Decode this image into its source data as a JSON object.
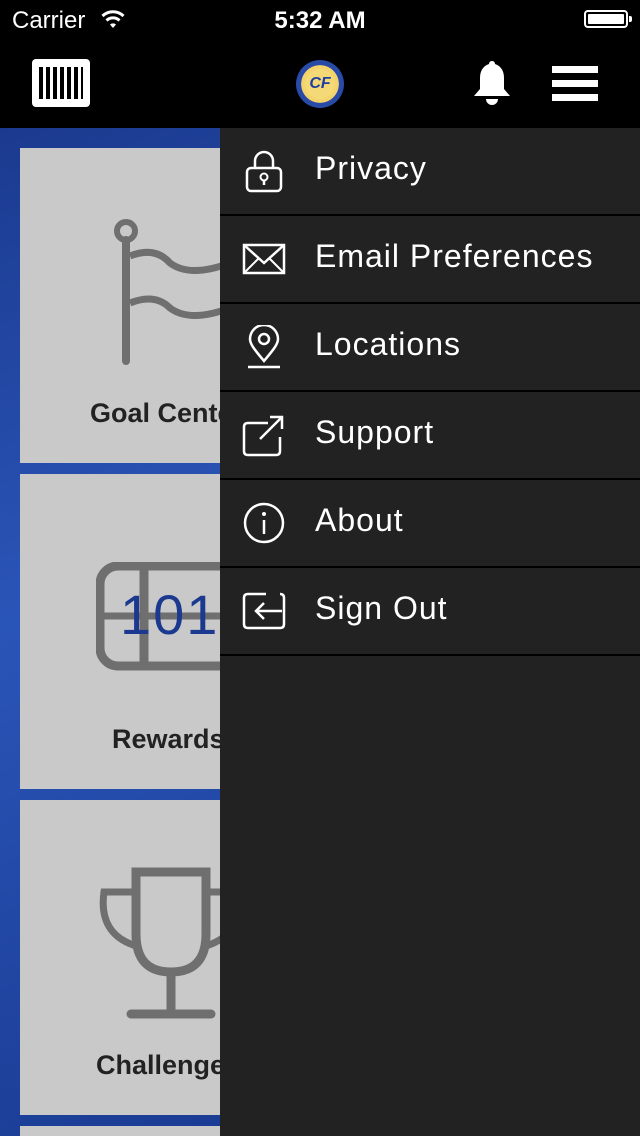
{
  "status_bar": {
    "carrier": "Carrier",
    "time": "5:32 AM"
  },
  "nav_bar": {
    "logo_text": "CF"
  },
  "tiles": {
    "goal": {
      "label": "Goal Center",
      "icon": "flag-icon"
    },
    "rewards": {
      "label": "Rewards",
      "number": "101",
      "icon": "ticket-icon"
    },
    "challenges": {
      "label": "Challenges",
      "icon": "trophy-icon"
    }
  },
  "menu": {
    "items": [
      {
        "label": "Privacy",
        "icon": "lock-icon"
      },
      {
        "label": "Email Preferences",
        "icon": "envelope-icon"
      },
      {
        "label": "Locations",
        "icon": "location-pin-icon"
      },
      {
        "label": "Support",
        "icon": "external-link-icon"
      },
      {
        "label": "About",
        "icon": "info-icon"
      },
      {
        "label": "Sign Out",
        "icon": "sign-out-icon"
      }
    ]
  },
  "colors": {
    "menu_bg": "#222222",
    "navbar_bg": "#000000",
    "content_blue": "#1b3a8f",
    "tile_gray": "#c9c9c9",
    "rewards_number": "#1b3a8f"
  }
}
